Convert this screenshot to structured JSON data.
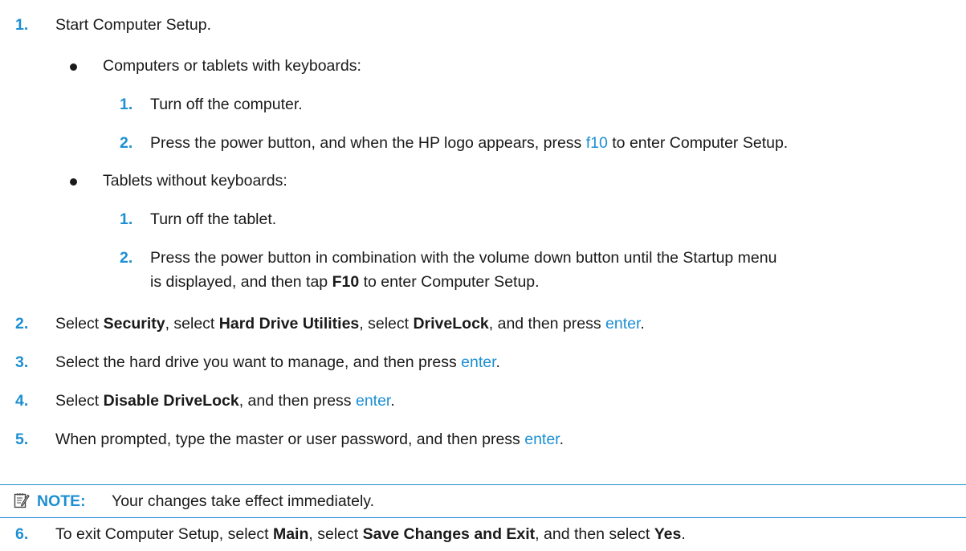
{
  "steps": {
    "s1": {
      "num": "1.",
      "text": "Start Computer Setup."
    },
    "b1": {
      "text": "Computers or tablets with keyboards:"
    },
    "b1_1": {
      "num": "1.",
      "text": "Turn off the computer."
    },
    "b1_2": {
      "num": "2.",
      "pre": "Press the power button, and when the HP logo appears, press ",
      "key": "f10",
      "post": " to enter Computer Setup."
    },
    "b2": {
      "text": "Tablets without keyboards:"
    },
    "b2_1": {
      "num": "1.",
      "text": "Turn off the tablet."
    },
    "b2_2": {
      "num": "2.",
      "line1": "Press the power button in combination with the volume down button until the Startup menu",
      "line2_pre": "is displayed, and then tap ",
      "line2_bold": "F10",
      "line2_post": " to enter Computer Setup."
    },
    "s2": {
      "num": "2.",
      "t1": "Select ",
      "b1": "Security",
      "t2": ", select ",
      "b2": "Hard Drive Utilities",
      "t3": ", select ",
      "b3": "DriveLock",
      "t4": ", and then press ",
      "key": "enter",
      "t5": "."
    },
    "s3": {
      "num": "3.",
      "pre": "Select the hard drive you want to manage, and then press ",
      "key": "enter",
      "post": "."
    },
    "s4": {
      "num": "4.",
      "t1": "Select ",
      "b1": "Disable DriveLock",
      "t2": ", and then press ",
      "key": "enter",
      "t3": "."
    },
    "s5": {
      "num": "5.",
      "pre": "When prompted, type the master or user password, and then press ",
      "key": "enter",
      "post": "."
    },
    "s6": {
      "num": "6.",
      "t1": "To exit Computer Setup, select ",
      "b1": "Main",
      "t2": ", select ",
      "b2": "Save Changes and Exit",
      "t3": ", and then select ",
      "b3": "Yes",
      "t4": "."
    }
  },
  "note": {
    "label": "NOTE:",
    "text": "Your changes take effect immediately.",
    "icon": "note-pencil-icon"
  },
  "colors": {
    "accent": "#1d8fd2",
    "text": "#1a1a1a"
  }
}
